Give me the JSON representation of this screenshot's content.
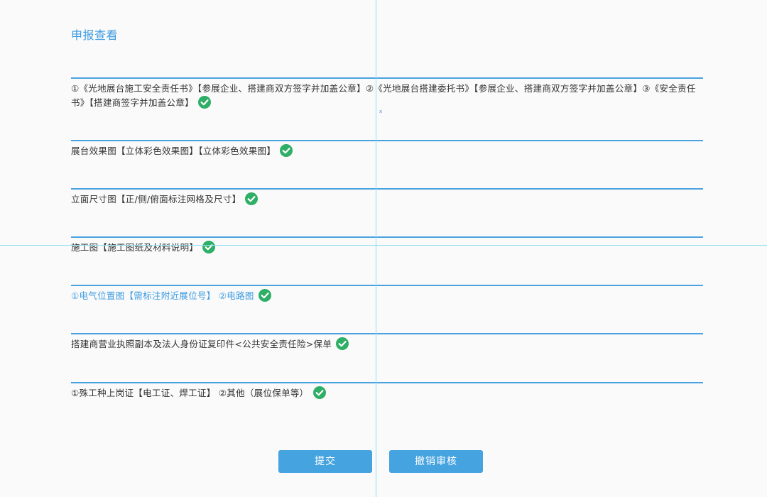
{
  "page": {
    "title": "申报查看"
  },
  "sections": [
    {
      "text": "①《光地展台施工安全责任书》【参展企业、搭建商双方签字并加盖公章】②《光地展台搭建委托书》【参展企业、搭建商双方签字并加盖公章】③《安全责任书》【搭建商签字并加盖公章】",
      "icon": "check-circle-icon"
    },
    {
      "text": "展台效果图【立体彩色效果图】【立体彩色效果图】",
      "icon": "check-circle-icon"
    },
    {
      "text": "立面尺寸图【正/侧/俯面标注网格及尺寸】",
      "icon": "check-circle-icon"
    },
    {
      "text": "施工图【施工图纸及材料说明】",
      "icon": "check-circle-icon"
    },
    {
      "text": "①电气位置图【需标注附近展位号】 ②电路图",
      "icon": "check-circle-icon"
    },
    {
      "text": "搭建商营业执照副本及法人身份证复印件<公共安全责任险>保单",
      "icon": "check-circle-icon"
    },
    {
      "text": "①殊工种上岗证【电工证、焊工证】 ②其他（展位保单等）",
      "icon": "check-circle-icon"
    }
  ],
  "stray_mark": "x",
  "buttons": {
    "submit": "提交",
    "withdraw": "撤销审核"
  },
  "colors": {
    "accent": "#3c9be0",
    "divider": "#4aa3e0",
    "button": "#45a3e0",
    "check": "#2fae66",
    "guide": "#8fe0ef"
  }
}
